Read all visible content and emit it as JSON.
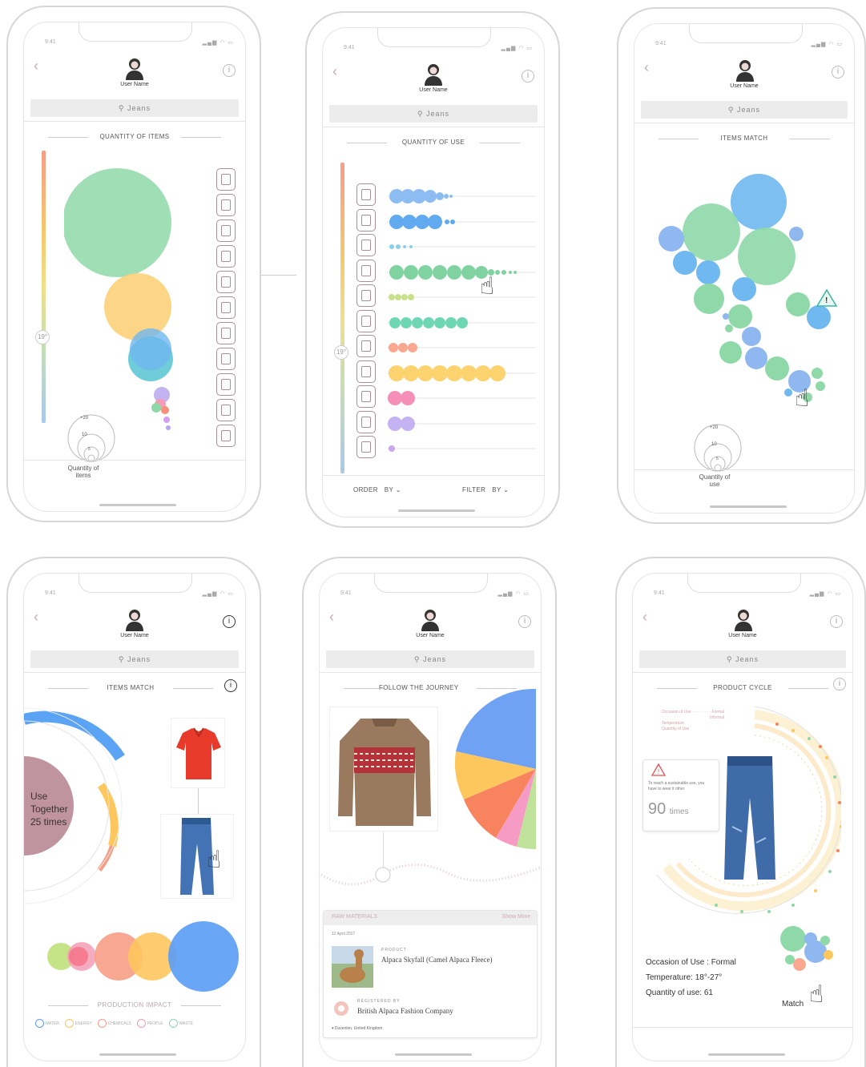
{
  "status": {
    "time": "9:41",
    "signal": "▂▄▆ ◠ ▭"
  },
  "header": {
    "user_name": "User Name",
    "search_query": "Jeans",
    "info": "i"
  },
  "screens": {
    "s1": {
      "title": "QUANTITY OF ITEMS",
      "degree": "19°",
      "legend": [
        "+20",
        "10",
        "5",
        "Quantity of",
        "items"
      ]
    },
    "s2": {
      "title": "QUANTITY OF USE",
      "degree": "19°",
      "order": "ORDER",
      "filter": "FILTER",
      "by": "BY ⌄"
    },
    "s3": {
      "title": "ITEMS MATCH",
      "warning": "!",
      "legend": [
        "+20",
        "10",
        "5",
        "Quantity of",
        "use"
      ]
    },
    "s4": {
      "title": "ITEMS MATCH",
      "use_together": [
        "Use",
        "Together",
        "25 times"
      ],
      "impact_title": "PRODUCTION IMPACT",
      "impact": [
        "WATER",
        "ENERGY",
        "CHEMICALS",
        "PEOPLE",
        "WASTE"
      ]
    },
    "s5": {
      "title": "FOLLOW THE JOURNEY",
      "raw_materials": "RAW MATERIALS",
      "show_more": "Show More",
      "date": "12 April 2017",
      "product_label": "PRODUCT",
      "product": "Alpaca Skyfall (Camel Alpaca Fleece)",
      "registered_label": "REGISTERED BY",
      "company": "British Alpaca Fashion Company",
      "location": "Duvenlon, United Kingdom"
    },
    "s6": {
      "title": "PRODUCT CYCLE",
      "small": [
        "Occasion of Use",
        "Formal",
        "Informal",
        "Temperature",
        "Quantity of Use"
      ],
      "tip": "To reach a sustainable use, you have to wear it other",
      "times_num": "90",
      "times": "times",
      "occasion": "Occasion of Use : Formal",
      "temperature": "Temperature: 18°-27°",
      "quantity": "Quantity of use: 61",
      "match": "Match"
    }
  },
  "colors": {
    "green": "#8fd8a8",
    "yellow": "#fdd07a",
    "blue": "#6fb8f0",
    "teal": "#28b6c6",
    "purple": "#b9a6ee",
    "pink": "#f49db5",
    "coral": "#f79d86",
    "mauve": "#c0949e",
    "accent": "#c7a9ae"
  },
  "icons": [
    "avatar-icon",
    "search-icon",
    "info-icon",
    "back-icon",
    "hand-pointer-icon",
    "warning-icon",
    "clothing-icon"
  ]
}
